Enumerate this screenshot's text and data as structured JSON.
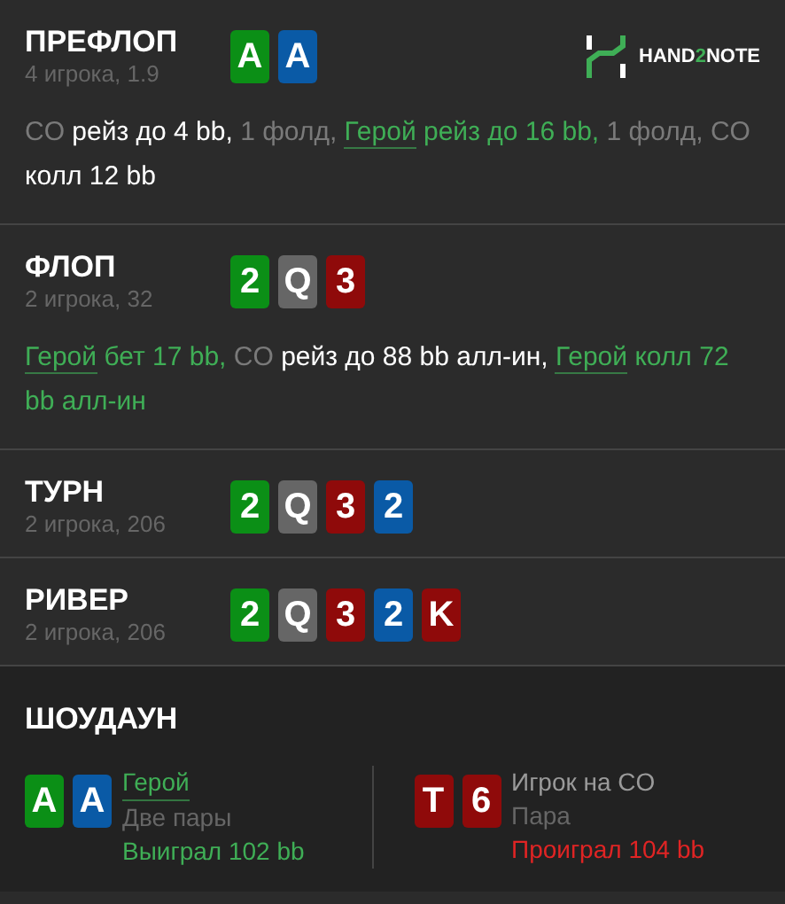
{
  "logo": {
    "parts": [
      {
        "text": "HAND",
        "kind": "plain"
      },
      {
        "text": "2",
        "kind": "accent"
      },
      {
        "text": "NOTE",
        "kind": "plain"
      }
    ]
  },
  "streets": [
    {
      "title": "ПРЕФЛОП",
      "info": "4 игрока, 1.9",
      "cards": [
        {
          "rank": "A",
          "color": "#0b8f16"
        },
        {
          "rank": "A",
          "color": "#0a5aa6"
        }
      ],
      "actions": [
        {
          "text": "CO",
          "kind": "player"
        },
        {
          "text": "рейз до 4 bb,",
          "kind": "action"
        },
        {
          "text": "1 фолд,",
          "kind": "player"
        },
        {
          "text": "Герой",
          "kind": "hero"
        },
        {
          "text": "рейз до 16 bb,",
          "kind": "hero_action"
        },
        {
          "text": "1 фолд,",
          "kind": "player"
        },
        {
          "text": "CO",
          "kind": "player"
        },
        {
          "text": "колл 12 bb",
          "kind": "action"
        }
      ]
    },
    {
      "title": "ФЛОП",
      "info": "2 игрока, 32",
      "cards": [
        {
          "rank": "2",
          "color": "#0b8f16"
        },
        {
          "rank": "Q",
          "color": "#666666"
        },
        {
          "rank": "3",
          "color": "#8f0a0a"
        }
      ],
      "actions": [
        {
          "text": "Герой",
          "kind": "hero"
        },
        {
          "text": "бет 17 bb,",
          "kind": "hero_action"
        },
        {
          "text": "CO",
          "kind": "player"
        },
        {
          "text": "рейз до 88 bb алл-ин,",
          "kind": "action"
        },
        {
          "text": "Герой",
          "kind": "hero"
        },
        {
          "text": "колл 72 bb алл-ин",
          "kind": "hero_action"
        }
      ]
    },
    {
      "title": "ТУРН",
      "info": "2 игрока, 206",
      "cards": [
        {
          "rank": "2",
          "color": "#0b8f16"
        },
        {
          "rank": "Q",
          "color": "#666666"
        },
        {
          "rank": "3",
          "color": "#8f0a0a"
        },
        {
          "rank": "2",
          "color": "#0a5aa6"
        }
      ]
    },
    {
      "title": "РИВЕР",
      "info": "2 игрока, 206",
      "cards": [
        {
          "rank": "2",
          "color": "#0b8f16"
        },
        {
          "rank": "Q",
          "color": "#666666"
        },
        {
          "rank": "3",
          "color": "#8f0a0a"
        },
        {
          "rank": "2",
          "color": "#0a5aa6"
        },
        {
          "rank": "K",
          "color": "#8f0a0a"
        }
      ]
    }
  ],
  "showdown": {
    "title": "ШОУДАУН",
    "players": [
      {
        "name": "Герой",
        "hero": true,
        "hand": "Две пары",
        "result": "Выиграл 102 bb",
        "won": true,
        "cards": [
          {
            "rank": "A",
            "color": "#0b8f16"
          },
          {
            "rank": "A",
            "color": "#0a5aa6"
          }
        ]
      },
      {
        "name": "Игрок на CO",
        "hero": false,
        "hand": "Пара",
        "result": "Проиграл 104 bb",
        "won": false,
        "cards": [
          {
            "rank": "T",
            "color": "#8f0a0a"
          },
          {
            "rank": "6",
            "color": "#8f0a0a"
          }
        ]
      }
    ]
  }
}
